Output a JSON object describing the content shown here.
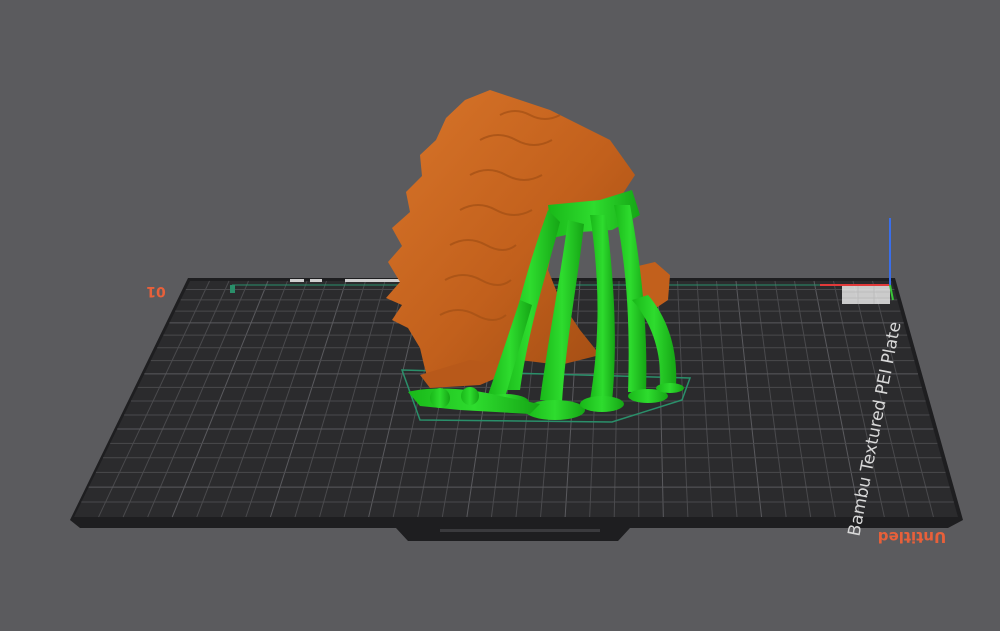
{
  "viewport": {
    "background": "#5b5b5e"
  },
  "plate": {
    "type_label": "Bambu Textured PEI Plate",
    "plate_number_label": "01",
    "project_name_label": "Untitled",
    "surface_color": "#2b2b2d",
    "grid_color": "#4a4a4d",
    "edge_color": "#1e1e20",
    "label_accent_color": "#e8603a"
  },
  "model": {
    "body_color": "#c8631e",
    "support_color": "#22cc22",
    "outline_color": "#2a8f6a"
  },
  "axes": {
    "x_color": "#e23a3a",
    "y_color": "#39c639",
    "z_color": "#3a6ee8"
  }
}
